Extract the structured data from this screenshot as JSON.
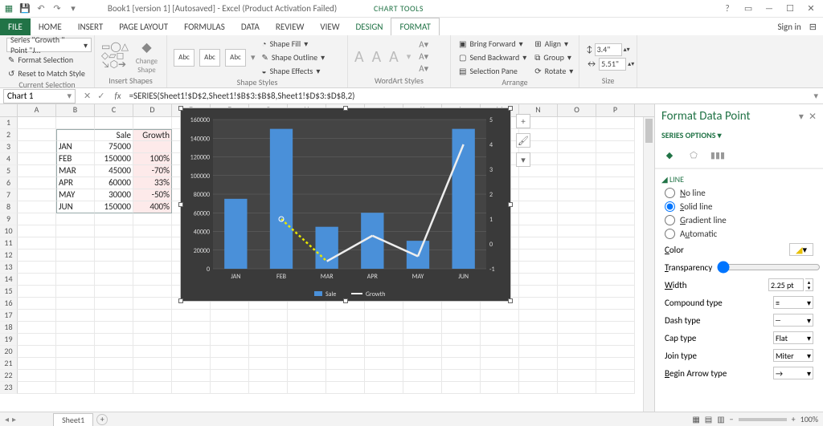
{
  "titlebar": {
    "title": "Book1 [version 1] [Autosaved] - Excel (Product Activation Failed)",
    "chart_tools": "CHART TOOLS"
  },
  "tabs": {
    "file": "FILE",
    "home": "HOME",
    "insert": "INSERT",
    "page_layout": "PAGE LAYOUT",
    "formulas": "FORMULAS",
    "data": "DATA",
    "review": "REVIEW",
    "view": "VIEW",
    "design": "DESIGN",
    "format": "FORMAT",
    "signin": "Sign in"
  },
  "ribbon": {
    "current_selection": {
      "label": "Current Selection",
      "seriesbox": "Series \"Growth \" Point \"J…",
      "format_selection": "Format Selection",
      "reset": "Reset to Match Style"
    },
    "insert_shapes": {
      "label": "Insert Shapes",
      "change": "Change Shape"
    },
    "shape_styles": {
      "label": "Shape Styles",
      "abc": "Abc",
      "fill": "Shape Fill",
      "outline": "Shape Outline",
      "effects": "Shape Effects"
    },
    "wordart": {
      "label": "WordArt Styles",
      "a": "A"
    },
    "arrange": {
      "label": "Arrange",
      "bring_forward": "Bring Forward",
      "send_backward": "Send Backward",
      "selection_pane": "Selection Pane",
      "align": "Align",
      "group": "Group",
      "rotate": "Rotate"
    },
    "size": {
      "label": "Size",
      "h": "3.4\"",
      "w": "5.51\""
    }
  },
  "formula_bar": {
    "name": "Chart 1",
    "formula": "=SERIES(Sheet1!$D$2,Sheet1!$B$3:$B$8,Sheet1!$D$3:$D$8,2)"
  },
  "columns": [
    "A",
    "B",
    "C",
    "D",
    "E",
    "F",
    "G",
    "H",
    "I",
    "J",
    "K",
    "L",
    "M",
    "N",
    "O",
    "P"
  ],
  "table": {
    "header": {
      "sale": "Sale",
      "growth": "Growth"
    },
    "rows": [
      {
        "month": "JAN",
        "sale": "75000",
        "growth": ""
      },
      {
        "month": "FEB",
        "sale": "150000",
        "growth": "100%"
      },
      {
        "month": "MAR",
        "sale": "45000",
        "growth": "-70%"
      },
      {
        "month": "APR",
        "sale": "60000",
        "growth": "33%"
      },
      {
        "month": "MAY",
        "sale": "30000",
        "growth": "-50%"
      },
      {
        "month": "JUN",
        "sale": "150000",
        "growth": "400%"
      }
    ]
  },
  "chart_data": {
    "type": "bar",
    "categories": [
      "JAN",
      "FEB",
      "MAR",
      "APR",
      "MAY",
      "JUN"
    ],
    "series": [
      {
        "name": "Sale",
        "values": [
          75000,
          150000,
          45000,
          60000,
          30000,
          150000
        ],
        "axis": "primary"
      },
      {
        "name": "Growth",
        "values": [
          null,
          1.0,
          -0.7,
          0.33,
          -0.5,
          4.0
        ],
        "axis": "secondary",
        "type": "line"
      }
    ],
    "ylim": [
      0,
      160000
    ],
    "ytick": 20000,
    "y2lim": [
      -1,
      5
    ],
    "y2tick": 1,
    "legend": [
      "Sale",
      "Growth"
    ]
  },
  "status": {
    "sheet": "Sheet1",
    "zoom": "100%"
  },
  "pane": {
    "title": "Format Data Point",
    "sub": "SERIES OPTIONS",
    "section": "LINE",
    "no_line": "No line",
    "solid": "Solid line",
    "gradient": "Gradient line",
    "auto": "Automatic",
    "color": "Color",
    "transparency": "Transparency",
    "transparency_val": "0%",
    "width": "Width",
    "width_val": "2.25 pt",
    "compound": "Compound type",
    "dash": "Dash type",
    "cap": "Cap type",
    "cap_val": "Flat",
    "join": "Join type",
    "join_val": "Miter",
    "begin_arrow": "Begin Arrow type"
  }
}
